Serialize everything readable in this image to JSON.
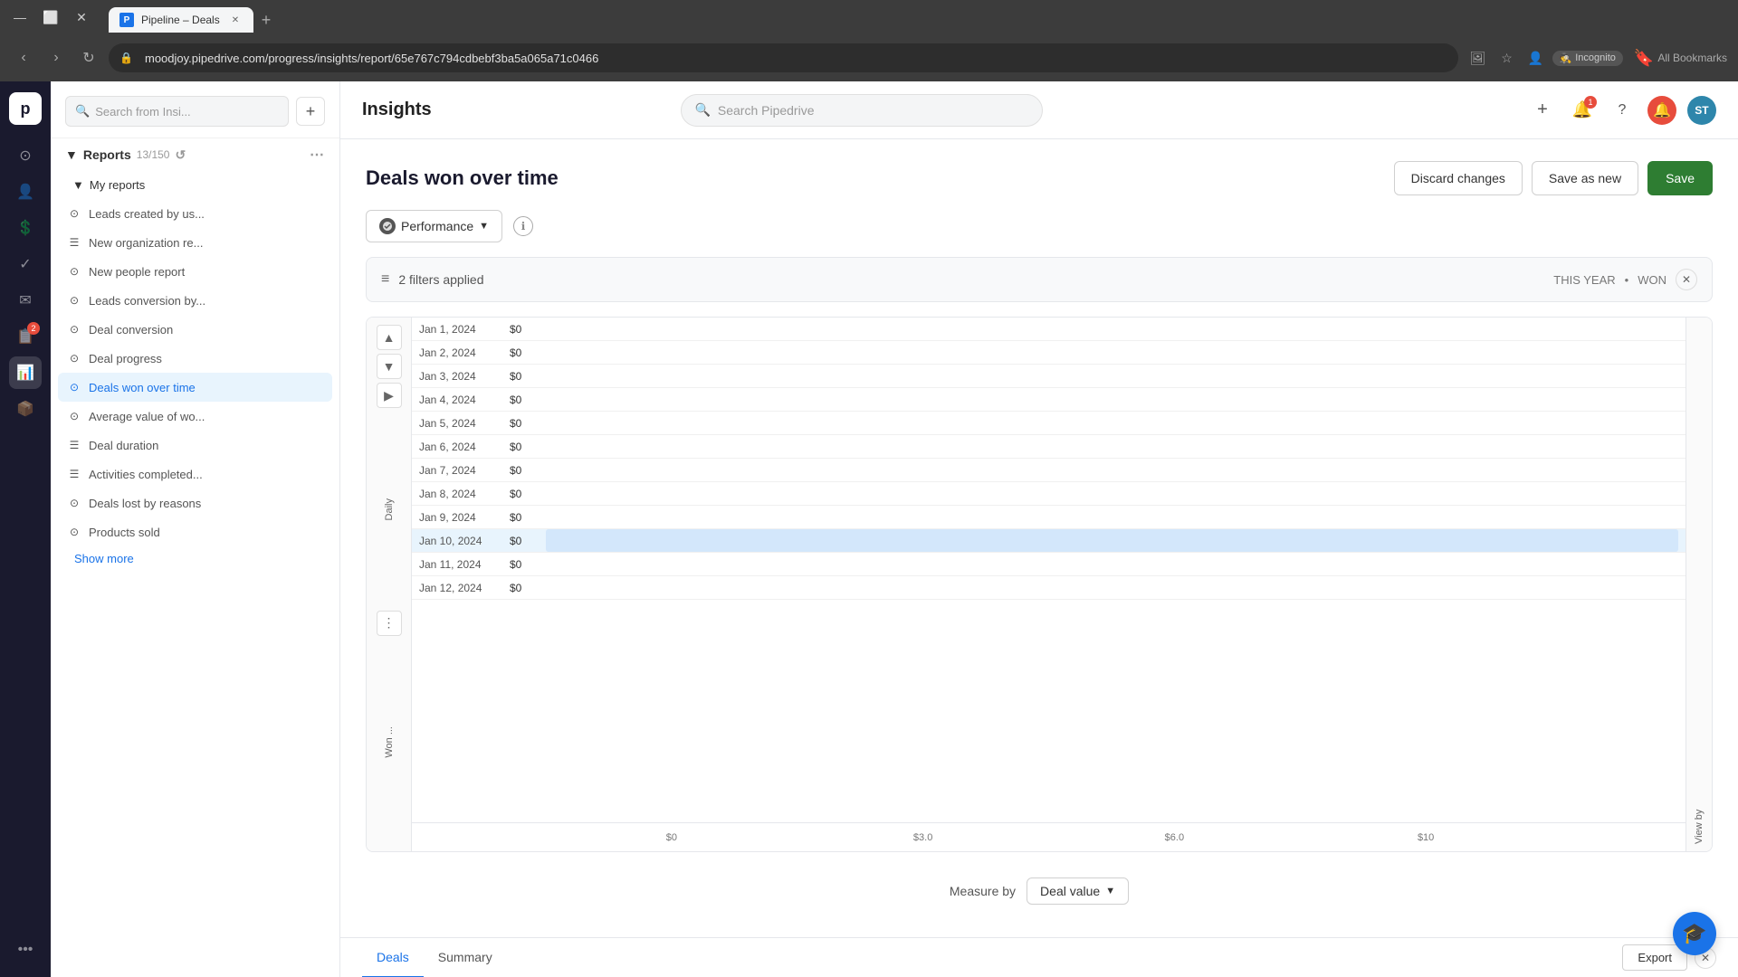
{
  "browser": {
    "tab_title": "Pipeline – Deals",
    "tab_favicon": "P",
    "url": "moodjoy.pipedrive.com/progress/insights/report/65e767c794cdbebf3ba5a065a71c0466",
    "incognito_label": "Incognito"
  },
  "app": {
    "title": "Insights",
    "search_placeholder": "Search Pipedrive"
  },
  "sidebar": {
    "search_placeholder": "Search from Insi...",
    "reports_label": "Reports",
    "count": "13/150",
    "my_reports_label": "My reports",
    "items": [
      {
        "id": "leads-created",
        "label": "Leads created by us...",
        "type": "circle"
      },
      {
        "id": "new-org",
        "label": "New organization re...",
        "type": "table"
      },
      {
        "id": "new-people",
        "label": "New people report",
        "type": "circle"
      },
      {
        "id": "leads-conversion",
        "label": "Leads conversion by...",
        "type": "circle"
      },
      {
        "id": "deal-conversion",
        "label": "Deal conversion",
        "type": "circle"
      },
      {
        "id": "deal-progress",
        "label": "Deal progress",
        "type": "circle"
      },
      {
        "id": "deals-won",
        "label": "Deals won over time",
        "type": "circle",
        "active": true
      },
      {
        "id": "avg-value",
        "label": "Average value of wo...",
        "type": "circle"
      },
      {
        "id": "deal-duration",
        "label": "Deal duration",
        "type": "table"
      },
      {
        "id": "activities-completed",
        "label": "Activities completed...",
        "type": "table"
      },
      {
        "id": "deals-lost",
        "label": "Deals lost by reasons",
        "type": "circle"
      },
      {
        "id": "products-sold",
        "label": "Products sold",
        "type": "circle"
      }
    ],
    "show_more_label": "Show more"
  },
  "report": {
    "title": "Deals won over time",
    "discard_label": "Discard changes",
    "save_as_new_label": "Save as new",
    "save_label": "Save",
    "performance_label": "Performance",
    "filters_applied": "2 filters applied",
    "filter_period": "THIS YEAR",
    "filter_status": "WON",
    "chart": {
      "rows": [
        {
          "date": "Jan 1, 2024",
          "value": "$0"
        },
        {
          "date": "Jan 2, 2024",
          "value": "$0"
        },
        {
          "date": "Jan 3, 2024",
          "value": "$0"
        },
        {
          "date": "Jan 4, 2024",
          "value": "$0"
        },
        {
          "date": "Jan 5, 2024",
          "value": "$0"
        },
        {
          "date": "Jan 6, 2024",
          "value": "$0"
        },
        {
          "date": "Jan 7, 2024",
          "value": "$0"
        },
        {
          "date": "Jan 8, 2024",
          "value": "$0"
        },
        {
          "date": "Jan 9, 2024",
          "value": "$0"
        },
        {
          "date": "Jan 10, 2024",
          "value": "$0",
          "highlighted": true
        },
        {
          "date": "Jan 11, 2024",
          "value": "$0"
        },
        {
          "date": "Jan 12, 2024",
          "value": "$0"
        }
      ],
      "axis_labels": [
        "$0",
        "$3.0",
        "$6.0",
        "$10"
      ],
      "daily_label": "Daily",
      "won_label": "Won ...",
      "view_by_label": "View by"
    },
    "measure_by_label": "Measure by",
    "measure_value": "Deal value",
    "tabs": [
      {
        "id": "deals",
        "label": "Deals",
        "active": true
      },
      {
        "id": "summary",
        "label": "Summary"
      }
    ],
    "export_label": "Export"
  },
  "nav": {
    "items": [
      {
        "id": "home",
        "icon": "⊙",
        "active": false
      },
      {
        "id": "contacts",
        "icon": "👤",
        "active": false
      },
      {
        "id": "deals",
        "icon": "$",
        "active": false
      },
      {
        "id": "activities",
        "icon": "✓",
        "active": false
      },
      {
        "id": "mail",
        "icon": "✉",
        "active": false
      },
      {
        "id": "leads",
        "icon": "📋",
        "badge": "2",
        "active": false
      },
      {
        "id": "reports",
        "icon": "📊",
        "active": true
      },
      {
        "id": "products",
        "icon": "📦",
        "active": false
      },
      {
        "id": "more",
        "icon": "•••",
        "active": false
      }
    ]
  },
  "user": {
    "initials": "ST",
    "notification_count": "1"
  }
}
